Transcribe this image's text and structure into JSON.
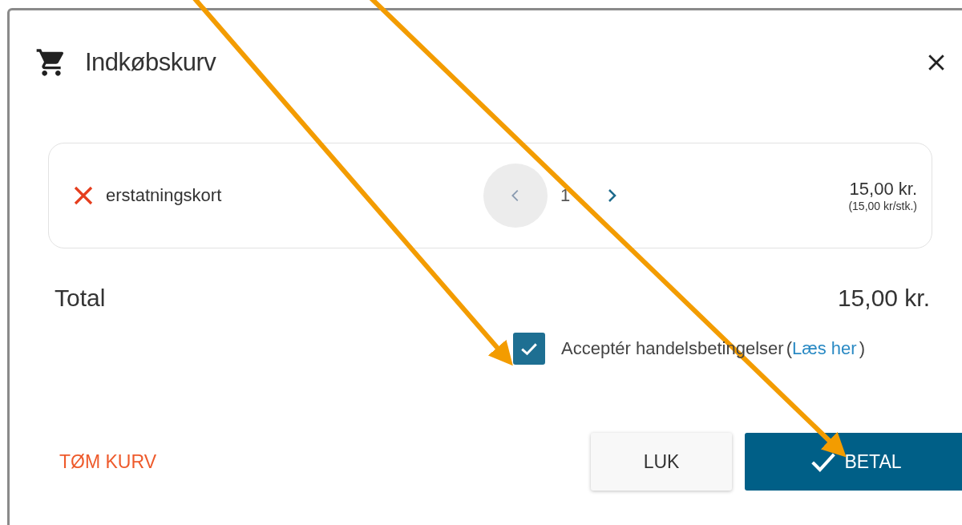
{
  "dialog": {
    "title": "Indkøbskurv"
  },
  "items": [
    {
      "name": "erstatningskort",
      "quantity": "1",
      "price": "15,00 kr.",
      "unit_price": "(15,00 kr/stk.)"
    }
  ],
  "total": {
    "label": "Total",
    "amount": "15,00 kr."
  },
  "terms": {
    "label": "Acceptér handelsbetingelser",
    "checked": true,
    "paren_open": "(",
    "link": "Læs her",
    "paren_close": ")"
  },
  "buttons": {
    "clear": "TØM KURV",
    "close": "LUK",
    "pay": "BETAL"
  },
  "annotations": [
    {
      "kind": "arrow"
    },
    {
      "kind": "arrow"
    }
  ]
}
